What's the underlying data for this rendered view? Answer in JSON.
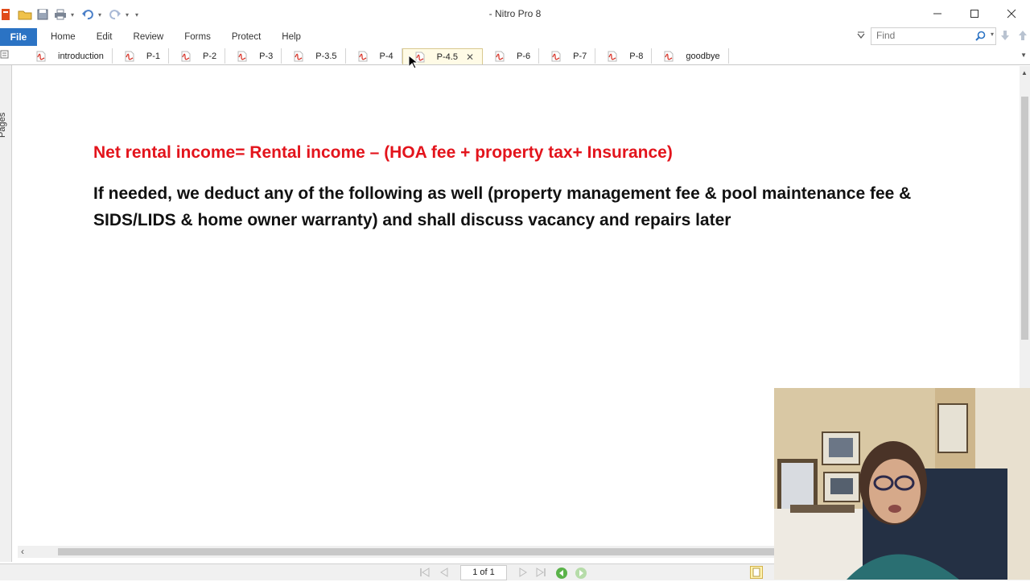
{
  "app": {
    "title": "- Nitro Pro 8"
  },
  "colors": {
    "accent": "#2b73c4",
    "heading_red": "#e3141c",
    "pdf_icon": "#d8352a"
  },
  "ribbon": {
    "file_label": "File",
    "tabs": [
      {
        "label": "Home"
      },
      {
        "label": "Edit"
      },
      {
        "label": "Review"
      },
      {
        "label": "Forms"
      },
      {
        "label": "Protect"
      },
      {
        "label": "Help"
      }
    ],
    "find": {
      "placeholder": "Find"
    }
  },
  "doc_tabs": [
    {
      "label": "introduction",
      "active": false
    },
    {
      "label": "P-1",
      "active": false
    },
    {
      "label": "P-2",
      "active": false
    },
    {
      "label": "P-3",
      "active": false
    },
    {
      "label": "P-3.5",
      "active": false
    },
    {
      "label": "P-4",
      "active": false
    },
    {
      "label": "P-4.5",
      "active": true
    },
    {
      "label": "P-6",
      "active": false
    },
    {
      "label": "P-7",
      "active": false
    },
    {
      "label": "P-8",
      "active": false
    },
    {
      "label": "goodbye",
      "active": false
    }
  ],
  "sidebar": {
    "pages_label": "Pages"
  },
  "document": {
    "formula": "Net rental income= Rental income – (HOA fee + property tax+ Insurance)",
    "paragraph": "If needed, we deduct any of the following as well (property management fee & pool maintenance fee & SIDS/LIDS & home owner warranty) and shall discuss vacancy and repairs later"
  },
  "status": {
    "page_indicator": "1 of 1"
  },
  "icons": {
    "qat": [
      "nitro-logo-icon",
      "open-folder-icon",
      "save-icon",
      "print-icon",
      "undo-icon",
      "redo-icon",
      "customize-icon"
    ],
    "window": [
      "minimize-icon",
      "maximize-icon",
      "close-icon"
    ]
  }
}
